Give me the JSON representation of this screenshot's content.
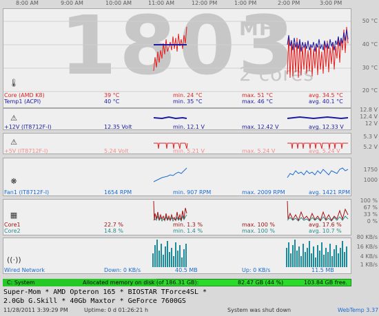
{
  "timeline": [
    "8:00 AM",
    "9:00 AM",
    "10:00 AM",
    "11:00 AM",
    "12:00 PM",
    "1:00 PM",
    "2:00 PM",
    "3:00 PM"
  ],
  "bg_display": {
    "digits": "1803",
    "unit": "MHz",
    "cores": "2 cores"
  },
  "temp_panel": {
    "yticks": [
      "50 °C",
      "40 °C",
      "30 °C",
      "20 °C"
    ],
    "rows": [
      {
        "name": "Core (AMD K8)",
        "current": "39 °C",
        "min": "min. 24 °C",
        "max": "max. 51 °C",
        "avg": "avg. 34.5 °C",
        "color": "#e02020"
      },
      {
        "name": "Temp1 (ACPI)",
        "current": "40 °C",
        "min": "min. 35 °C",
        "max": "max. 46 °C",
        "avg": "avg. 40.1 °C",
        "color": "#1a1aa0"
      }
    ],
    "icon": "thermometer-icon"
  },
  "v12_panel": {
    "yticks": [
      "12.8 V",
      "12.4 V",
      "12 V"
    ],
    "row": {
      "name": "+12V (IT8712F-I)",
      "current": "12.35 Volt",
      "min": "min. 12.1 V",
      "max": "max. 12.42 V",
      "avg": "avg. 12.33 V",
      "color": "#1a1aa0"
    },
    "icon": "warning-icon"
  },
  "v5_panel": {
    "yticks": [
      "5.3 V",
      "5.2 V"
    ],
    "row": {
      "name": "+5V (IT8712F-I)",
      "current": "5.24 Volt",
      "min": "min. 5.21 V",
      "max": "max. 5.24 V",
      "avg": "avg. 5.24 V",
      "color": "#f08a8a"
    },
    "icon": "warning-icon"
  },
  "fan_panel": {
    "yticks": [
      "1750",
      "1000"
    ],
    "row": {
      "name": "Fan1 (IT8712F-I)",
      "current": "1654 RPM",
      "min": "min. 907 RPM",
      "max": "max. 2009 RPM",
      "avg": "avg. 1421 RPM",
      "color": "#1a6ad0"
    },
    "icon": "fan-icon"
  },
  "cpu_panel": {
    "yticks": [
      "100 %",
      "67 %",
      "33 %",
      "0 %"
    ],
    "rows": [
      {
        "name": "Core1",
        "current": "22.7 %",
        "min": "min. 1.3 %",
        "max": "max. 100 %",
        "avg": "avg. 17.6 %",
        "color": "#a01010"
      },
      {
        "name": "Core2",
        "current": "14.8 %",
        "min": "min. 1.4 %",
        "max": "max. 100 %",
        "avg": "avg. 10.7 %",
        "color": "#2a8a8a"
      }
    ],
    "icon": "cpu-icon"
  },
  "net_panel": {
    "yticks": [
      "80 KB/s",
      "16 KB/s",
      "4 KB/s",
      "1 KB/s"
    ],
    "row": {
      "name": "Wired Network",
      "down": "Down: 0 KB/s",
      "down_total": "40.5 MB",
      "up": "Up: 0 KB/s",
      "up_total": "11.5 MB",
      "color": "#1a6ad0"
    },
    "icon": "network-icon"
  },
  "disk": {
    "label": "C: System",
    "allocated": "Allocated memory on disk (of 186.31 GB):",
    "used": "82.47 GB (44 %)",
    "free": "103.84 GB free.",
    "fraction": 0.44
  },
  "info_lines": [
    "Super-Mom * AMD Opteron 165 * BIOSTAR TForce4SL *",
    "2.0Gb G.Skill * 40Gb Maxtor * GeForce 7600GS"
  ],
  "footer": {
    "datetime": "11/28/2011 3:39:29 PM",
    "uptime": "Uptime: 0 d 01:26:21 h",
    "status": "System was shut down",
    "app": "WebTemp 3.37"
  },
  "colors": {
    "red": "#e02020",
    "blue": "#1a1aa0",
    "teal": "#1a8a9a",
    "green": "#2adb2a"
  }
}
